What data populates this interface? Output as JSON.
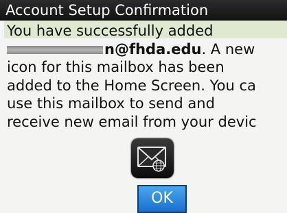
{
  "dialog": {
    "title": "Account Setup Confirmation",
    "message": {
      "line1": "You have successfully added",
      "email_visible": "n@fhda.edu",
      "line2_suffix": ". A new",
      "line3": "icon for this mailbox has been",
      "line4": "added to the Home Screen. You ca",
      "line5": "use this mailbox to send and",
      "line6": "receive new email from your devic"
    },
    "icon": "mailbox-icon",
    "ok_label": "OK"
  },
  "colors": {
    "title_bar": "#1a1a1a",
    "message_highlight": "#dfe9d2",
    "ok_button": "#2a86e0"
  }
}
